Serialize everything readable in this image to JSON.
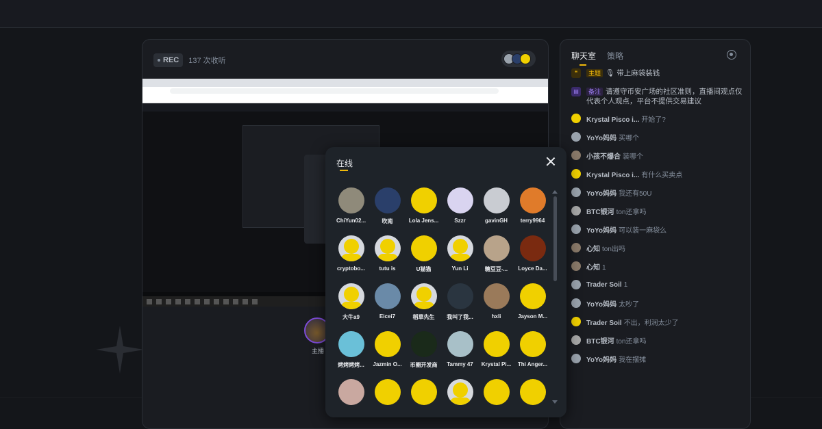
{
  "stream": {
    "rec_label": "REC",
    "listen_count": "137 次收听",
    "host_label": "主播"
  },
  "chat": {
    "tab_chatroom": "聊天室",
    "tab_strategy": "策略",
    "pinned": [
      {
        "tag": "主题",
        "text": "🎙 带上麻袋装钱"
      },
      {
        "tag": "备注",
        "text": "请遵守币安广场的社区准则，直播间观点仅代表个人观点，平台不提供交易建议"
      }
    ],
    "messages": [
      {
        "user": "Krystal Pisco i...",
        "text": "开始了?"
      },
      {
        "user": "YoYo妈妈",
        "text": "买哪个"
      },
      {
        "user": "小孩不爆合",
        "text": "装哪个"
      },
      {
        "user": "Krystal Pisco i...",
        "text": "有什么买卖点"
      },
      {
        "user": "YoYo妈妈",
        "text": "我还有50U"
      },
      {
        "user": "BTC银河",
        "text": "ton还拿吗"
      },
      {
        "user": "YoYo妈妈",
        "text": "可以装一麻袋么"
      },
      {
        "user": "心知",
        "text": "ton出吗"
      },
      {
        "user": "心知",
        "text": "1"
      },
      {
        "user": "Trader Soil",
        "text": "1"
      },
      {
        "user": "YoYo妈妈",
        "text": "太吵了"
      },
      {
        "user": "Trader Soil",
        "text": "不出，利润太少了"
      },
      {
        "user": "BTC银河",
        "text": "ton还拿吗"
      },
      {
        "user": "YoYo妈妈",
        "text": "我在摆摊"
      }
    ]
  },
  "online_modal": {
    "title": "在线",
    "users": [
      {
        "name": "ChiYun02...",
        "color": "#8f8a7a"
      },
      {
        "name": "吹南",
        "color": "#2a3f6a"
      },
      {
        "name": "Lola Jens...",
        "color": "#f0d000"
      },
      {
        "name": "Szzr",
        "color": "#d9d4f0"
      },
      {
        "name": "gavinGH",
        "color": "#c9ccd2"
      },
      {
        "name": "terry9964",
        "color": "#e07b2a"
      },
      {
        "name": "cryptobo...",
        "color": "yellow"
      },
      {
        "name": "tutu is",
        "color": "yellow"
      },
      {
        "name": "U猫猫",
        "color": "#f0d000"
      },
      {
        "name": "Yun Li",
        "color": "yellow"
      },
      {
        "name": "糖豆豆-...",
        "color": "#b8a38a"
      },
      {
        "name": "Loyce Da...",
        "color": "#7a2a10"
      },
      {
        "name": "大牛a9",
        "color": "yellow"
      },
      {
        "name": "Eicei7",
        "color": "#6a8aa8"
      },
      {
        "name": "稻草先生",
        "color": "yellow"
      },
      {
        "name": "我叫了我...",
        "color": "#2a3540"
      },
      {
        "name": "hxli",
        "color": "#9a7a5a"
      },
      {
        "name": "Jayson M...",
        "color": "#f0d000"
      },
      {
        "name": "烤烤烤烤...",
        "color": "#6ac0d8"
      },
      {
        "name": "Jazmin O...",
        "color": "#f0d000"
      },
      {
        "name": "币圈开发商",
        "color": "#1a2a1a"
      },
      {
        "name": "Tammy 47",
        "color": "#a8c0c8"
      },
      {
        "name": "Krystal Pi...",
        "color": "#f0d000"
      },
      {
        "name": "Thi Anger...",
        "color": "#f0d000"
      },
      {
        "name": "",
        "color": "#c9a8a0"
      },
      {
        "name": "",
        "color": "#f0d000"
      },
      {
        "name": "",
        "color": "#f0d000"
      },
      {
        "name": "",
        "color": "yellow"
      },
      {
        "name": "",
        "color": "#f0d000"
      },
      {
        "name": "",
        "color": "#f0d000"
      }
    ]
  },
  "colors": {
    "accent": "#f0b90b",
    "panel": "#1a1c21",
    "modal": "#1e2329"
  },
  "icons": [
    "close-icon",
    "settings-icon",
    "quote-icon",
    "note-icon",
    "scroll-up-icon",
    "scroll-down-icon"
  ]
}
